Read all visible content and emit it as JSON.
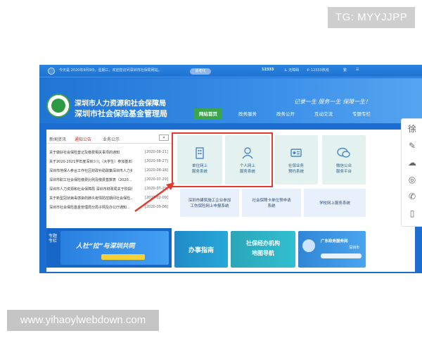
{
  "overlays": {
    "telegram_tag": "TG: MYYJJPP",
    "watermark": "www.yihaoylwebdown.com"
  },
  "topbar": {
    "date_text": "今天是 2020年9月9日，星期三，欢迎您访问深圳市社保局网站。",
    "button_label": "适老化",
    "hotline": "12333热线",
    "simplified": "繁",
    "accessibility": "无障碍"
  },
  "header": {
    "org_name": "深圳市人力资源和社会保障局",
    "fund_name": "深圳市社会保险基金管理局",
    "slogan": "记录一生 服务一生 保障一生！"
  },
  "nav": {
    "items": [
      "网站首页",
      "政务服务",
      "政务公开",
      "互动交流",
      "专题专栏"
    ],
    "active_index": 0
  },
  "news": {
    "tabs": [
      "新闻资讯",
      "通知公告",
      "业务公示"
    ],
    "active_tab": 1,
    "more": "»",
    "items": [
      {
        "title": "关于做好社会保险登记及缴费相关事项的通知",
        "date": "[2020-08-21]"
      },
      {
        "title": "关于2020-2021学年度深圳少儿（大学生）参加基本医疗保险...",
        "date": "[2020-08-27]"
      },
      {
        "title": "深圳市地保人参合工作社区财政补助政策深圳市人力资源...",
        "date": "[2020-08-18]"
      },
      {
        "title": "深圳市职工社会保险缴费比例及缴费基数表（2020...",
        "date": "[2020-07-29]"
      },
      {
        "title": "深圳市人力资源和社会保障局 深圳市财政局关于阶段性...",
        "date": "[2020-07-29]"
      },
      {
        "title": "关于新型冠状病毒感染的肺炎疫情防控期间社会保险...",
        "date": "[2020-02-09]"
      },
      {
        "title": "深圳市社会保险基金管理局分局子网及办公厅通知...",
        "date": "[2020-09-08]"
      }
    ]
  },
  "services": {
    "large": [
      {
        "label1": "单位网上",
        "label2": "服务系统",
        "icon": "building-icon"
      },
      {
        "label1": "个人网上",
        "label2": "服务系统",
        "icon": "person-icon"
      },
      {
        "label1": "社保业务",
        "label2": "预约系统",
        "icon": "id-card-icon"
      },
      {
        "label1": "微信公众",
        "label2": "服务平台",
        "icon": "wechat-icon"
      }
    ],
    "small": [
      {
        "label1": "深圳市建筑施工企业参加",
        "label2": "工伤保险网上申报系统"
      },
      {
        "label1": "社会保障卡单位预申请",
        "label2": "系统"
      },
      {
        "label1": "学校网上服务系统",
        "label2": ""
      }
    ]
  },
  "banners": {
    "topic_label": "专题专栏",
    "topic_text": "人社“拉”与深圳共同",
    "guide": "办事指南",
    "map_line1": "社保经办机构",
    "map_line2": "地图导航",
    "gov_title": "广东政务服务网",
    "gov_sub": "深圳市"
  },
  "colors": {
    "site_blue": "#1c6fd0",
    "nav_active": "#3aa54d",
    "highlight_red": "#e23a2e",
    "tile_green": "#e3f2ef",
    "tile_blue": "#e8f0fb"
  }
}
